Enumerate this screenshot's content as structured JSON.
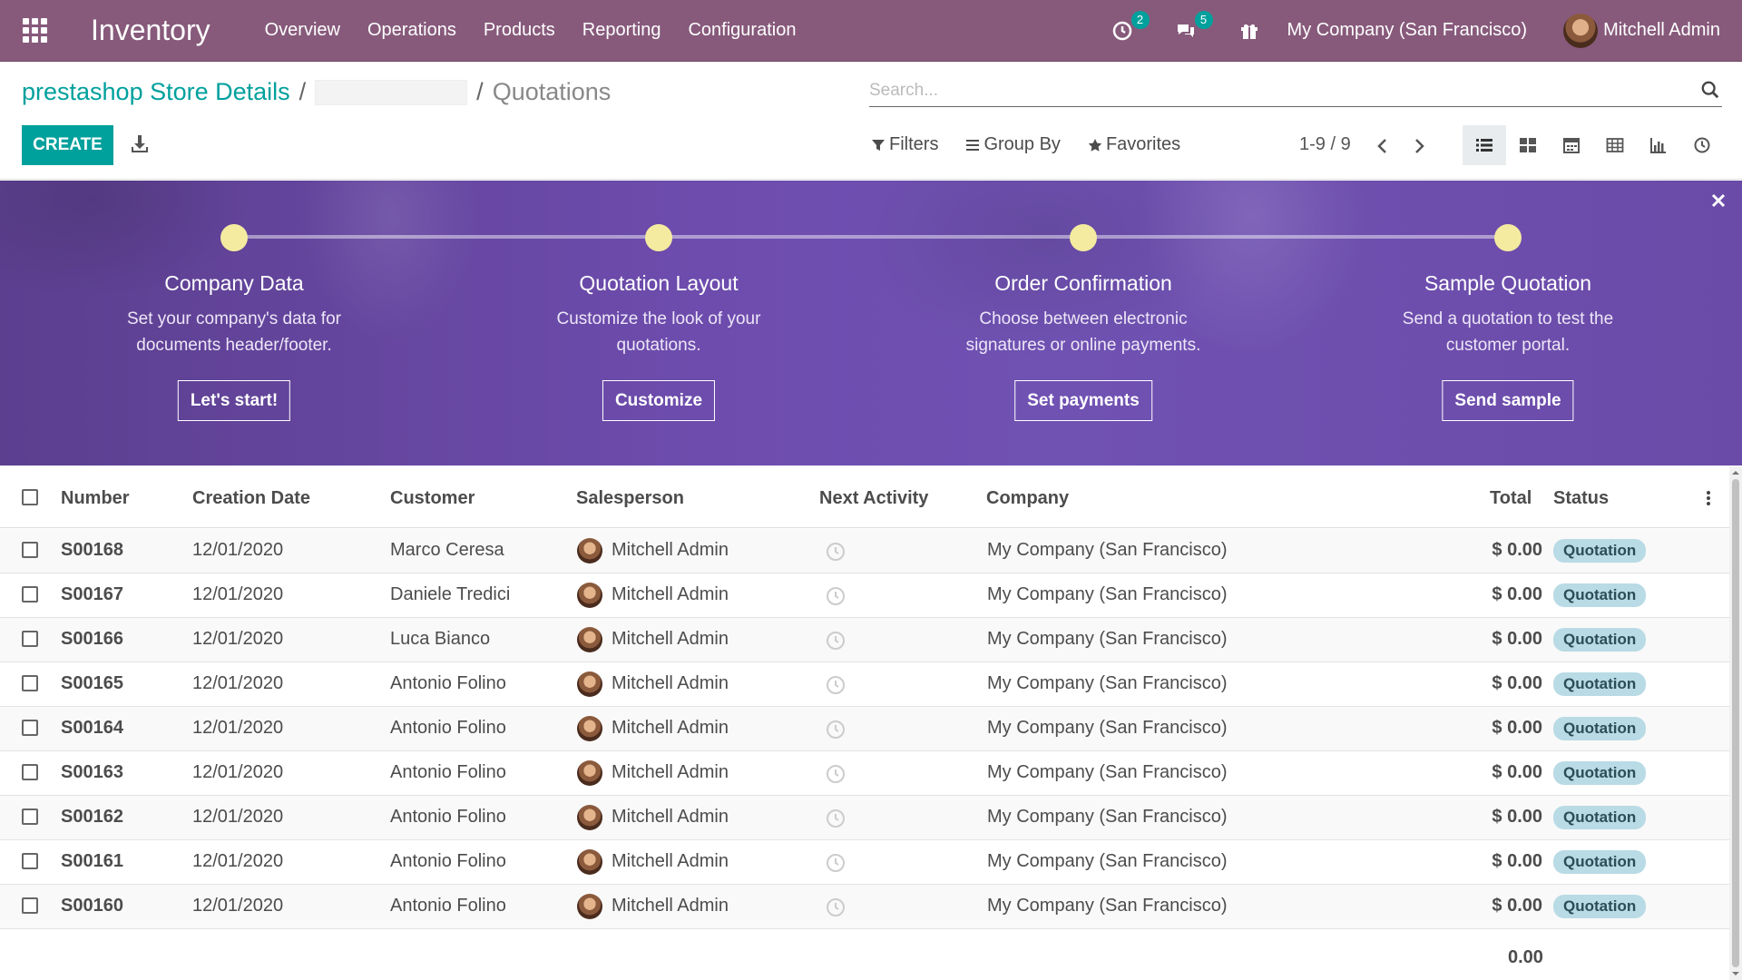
{
  "app": {
    "title": "Inventory",
    "menu": [
      "Overview",
      "Operations",
      "Products",
      "Reporting",
      "Configuration"
    ],
    "activity_count": "2",
    "messages_count": "5",
    "company": "My Company (San Francisco)",
    "user": "Mitchell Admin",
    "accent_color": "#875a7b",
    "primary_color": "#00a09d"
  },
  "breadcrumb": {
    "root": "prestashop Store Details",
    "separator": "/",
    "current": "Quotations"
  },
  "search": {
    "placeholder": "Search..."
  },
  "toolbar": {
    "create_label": "CREATE",
    "filters_label": "Filters",
    "groupby_label": "Group By",
    "favorites_label": "Favorites",
    "pager": "1-9 / 9",
    "icons": [
      "download-icon",
      "list-view-icon",
      "kanban-view-icon",
      "calendar-view-icon",
      "pivot-view-icon",
      "graph-view-icon",
      "activity-view-icon"
    ]
  },
  "banner": {
    "steps": [
      {
        "title": "Company Data",
        "desc": "Set your company's data for documents header/footer.",
        "button": "Let's start!"
      },
      {
        "title": "Quotation Layout",
        "desc": "Customize the look of your quotations.",
        "button": "Customize"
      },
      {
        "title": "Order Confirmation",
        "desc": "Choose between electronic signatures or online payments.",
        "button": "Set payments"
      },
      {
        "title": "Sample Quotation",
        "desc": "Send a quotation to test the customer portal.",
        "button": "Send sample"
      }
    ]
  },
  "table": {
    "columns": [
      "Number",
      "Creation Date",
      "Customer",
      "Salesperson",
      "Next Activity",
      "Company",
      "Total",
      "Status"
    ],
    "rows": [
      {
        "number": "S00168",
        "date": "12/01/2020",
        "customer": "Marco Ceresa",
        "salesperson": "Mitchell Admin",
        "company": "My Company (San Francisco)",
        "total": "$ 0.00",
        "status": "Quotation"
      },
      {
        "number": "S00167",
        "date": "12/01/2020",
        "customer": "Daniele Tredici",
        "salesperson": "Mitchell Admin",
        "company": "My Company (San Francisco)",
        "total": "$ 0.00",
        "status": "Quotation"
      },
      {
        "number": "S00166",
        "date": "12/01/2020",
        "customer": "Luca Bianco",
        "salesperson": "Mitchell Admin",
        "company": "My Company (San Francisco)",
        "total": "$ 0.00",
        "status": "Quotation"
      },
      {
        "number": "S00165",
        "date": "12/01/2020",
        "customer": "Antonio Folino",
        "salesperson": "Mitchell Admin",
        "company": "My Company (San Francisco)",
        "total": "$ 0.00",
        "status": "Quotation"
      },
      {
        "number": "S00164",
        "date": "12/01/2020",
        "customer": "Antonio Folino",
        "salesperson": "Mitchell Admin",
        "company": "My Company (San Francisco)",
        "total": "$ 0.00",
        "status": "Quotation"
      },
      {
        "number": "S00163",
        "date": "12/01/2020",
        "customer": "Antonio Folino",
        "salesperson": "Mitchell Admin",
        "company": "My Company (San Francisco)",
        "total": "$ 0.00",
        "status": "Quotation"
      },
      {
        "number": "S00162",
        "date": "12/01/2020",
        "customer": "Antonio Folino",
        "salesperson": "Mitchell Admin",
        "company": "My Company (San Francisco)",
        "total": "$ 0.00",
        "status": "Quotation"
      },
      {
        "number": "S00161",
        "date": "12/01/2020",
        "customer": "Antonio Folino",
        "salesperson": "Mitchell Admin",
        "company": "My Company (San Francisco)",
        "total": "$ 0.00",
        "status": "Quotation"
      },
      {
        "number": "S00160",
        "date": "12/01/2020",
        "customer": "Antonio Folino",
        "salesperson": "Mitchell Admin",
        "company": "My Company (San Francisco)",
        "total": "$ 0.00",
        "status": "Quotation"
      }
    ],
    "footer_total": "0.00"
  }
}
